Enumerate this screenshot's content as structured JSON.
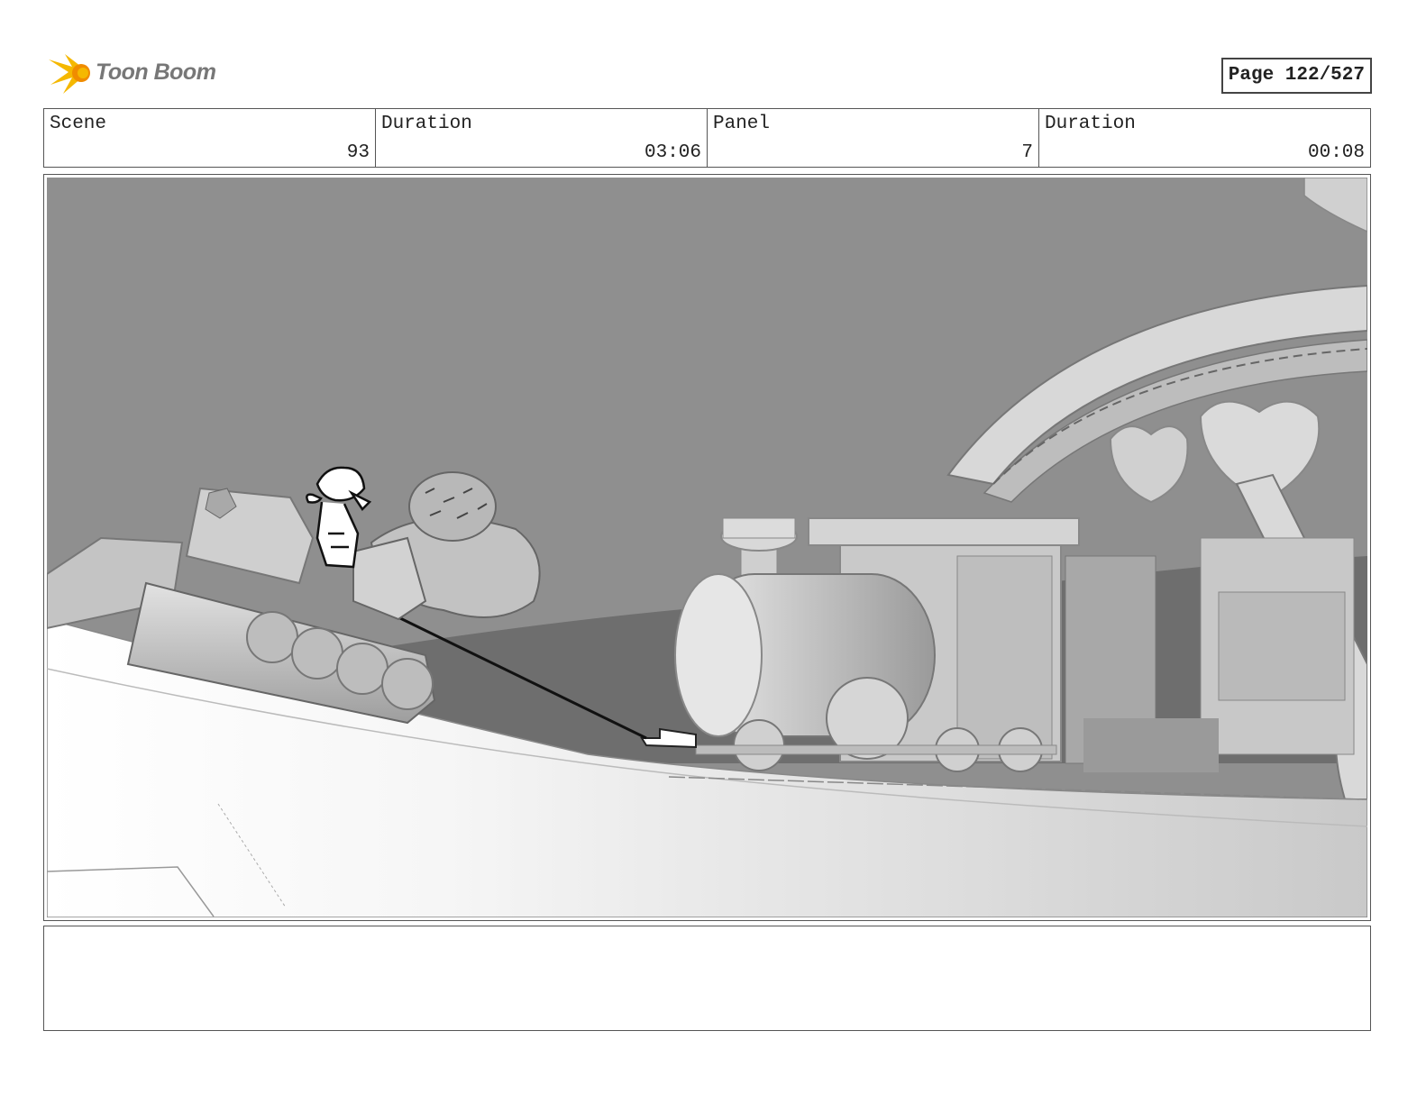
{
  "header": {
    "logo_text": "Toon Boom",
    "page_label": "Page 122/527"
  },
  "info": {
    "scene_label": "Scene",
    "scene_value": "93",
    "scene_duration_label": "Duration",
    "scene_duration_value": "03:06",
    "panel_label": "Panel",
    "panel_value": "7",
    "panel_duration_label": "Duration",
    "panel_duration_value": "00:08"
  },
  "notes": {
    "text": ""
  },
  "colors": {
    "logo_yellow": "#f5b800",
    "logo_orange": "#f08c00",
    "sky_gray": "#8f8f8f",
    "ground_white": "#f4f4f4"
  }
}
